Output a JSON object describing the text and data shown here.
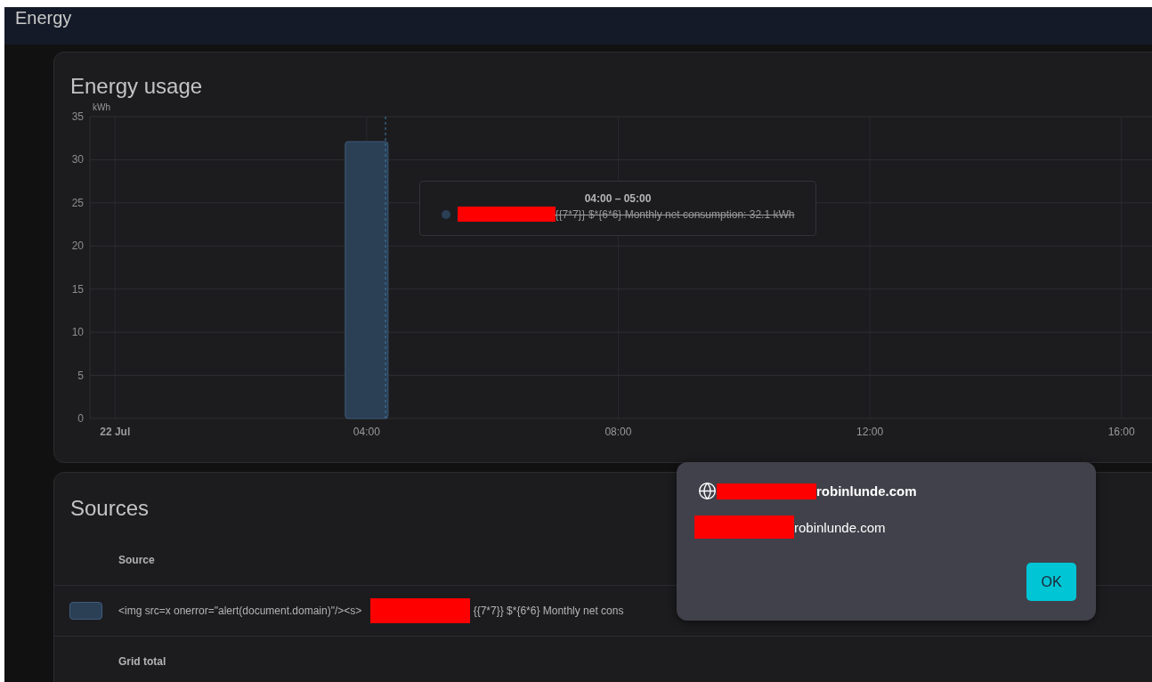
{
  "header": {
    "title": "Energy"
  },
  "energy_usage": {
    "title": "Energy usage",
    "chart_data": {
      "type": "bar",
      "ylabel": "kWh",
      "grid": true,
      "x": [
        4
      ],
      "series": [
        {
          "color": "#2b3f55",
          "values": [
            32.1
          ]
        }
      ],
      "ref_lines": [
        {
          "axis": "x",
          "value": 4.3
        }
      ],
      "xlim": [
        -0.4,
        16.5
      ],
      "ylim": [
        0,
        35
      ],
      "xticks": [
        {
          "value": 0,
          "label": "22 Jul"
        },
        {
          "value": 4,
          "label": "04:00"
        },
        {
          "value": 8,
          "label": "08:00"
        },
        {
          "value": 12,
          "label": "12:00"
        },
        {
          "value": 16,
          "label": "16:00"
        }
      ],
      "yticks": [
        0,
        5,
        10,
        15,
        20,
        25,
        30,
        35
      ]
    },
    "tooltip": {
      "title": "04:00 – 05:00",
      "label": "{{7*7}} $*{6*6} Monthly net consumption: 32.1 kWh",
      "strikethrough": true,
      "redacted": true
    }
  },
  "sources": {
    "title": "Sources",
    "columns": [
      "Source"
    ],
    "rows": [
      {
        "kind": "source",
        "prefix": "<img src=x onerror=\"alert(document.domain)\"/><s>",
        "redacted": true,
        "label": "{{7*7}} $*{6*6} Monthly net cons"
      },
      {
        "kind": "total",
        "label": "Grid total"
      }
    ]
  },
  "alert": {
    "origin": "robinlunde.com",
    "message": "robinlunde.com",
    "redacted": true,
    "button": "OK"
  }
}
